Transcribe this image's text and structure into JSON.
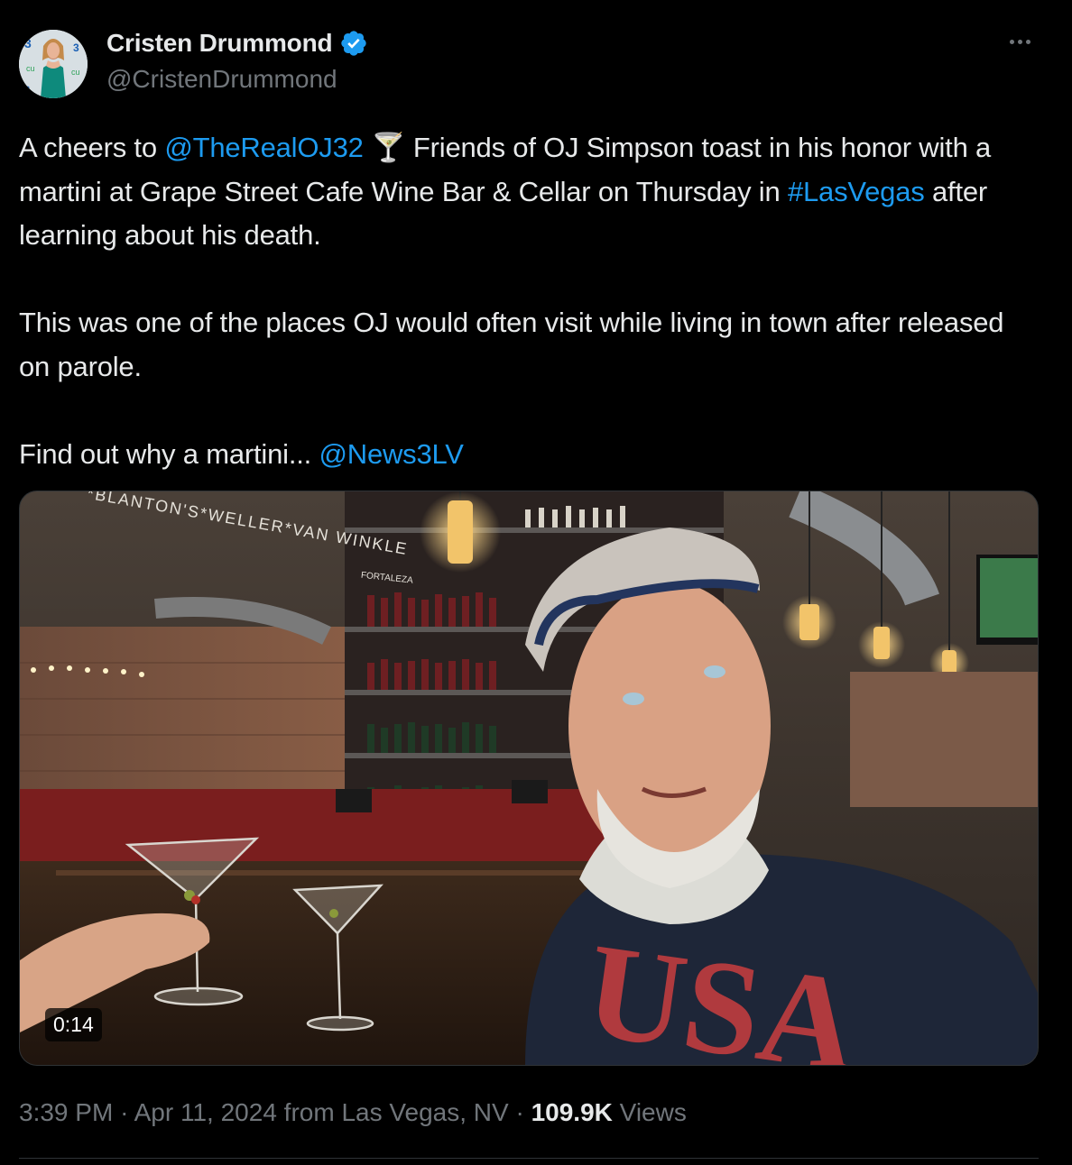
{
  "author": {
    "display_name": "Cristen Drummond",
    "handle": "@CristenDrummond",
    "verified": true,
    "avatar_icon": "profile-photo"
  },
  "tweet": {
    "p1_a": "A cheers to ",
    "p1_mention": "@TheRealOJ32",
    "p1_emoji": "🍸",
    "p1_b": " Friends of OJ Simpson toast in his honor with a martini at Grape Street Cafe Wine Bar & Cellar on Thursday in ",
    "p1_hashtag": "#LasVegas",
    "p1_c": " after learning about his death.",
    "p2": "This was one of the places OJ would often visit while living in town after released on parole.",
    "p3_a": "Find out why a martini... ",
    "p3_mention": "@News3LV"
  },
  "media": {
    "type": "video",
    "duration": "0:14",
    "sign_text": "*BLANTON'S*WELLER*VAN WINKLE",
    "sign_text_2": "FORTALEZA",
    "shirt_text": "USA"
  },
  "meta": {
    "time": "3:39 PM",
    "date": "Apr 11, 2024",
    "location": "from Las Vegas, NV",
    "views_count": "109.9K",
    "views_label": "Views",
    "separator": "·"
  },
  "colors": {
    "background": "#000000",
    "text": "#e7e9ea",
    "secondary": "#71767b",
    "link": "#1d9bf0",
    "verified": "#1d9bf0"
  }
}
